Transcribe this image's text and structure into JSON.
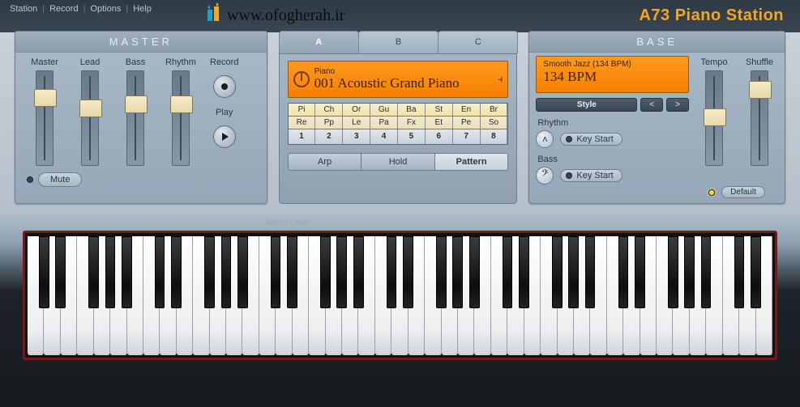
{
  "menu": {
    "items": [
      "Station",
      "Record",
      "Options",
      "Help"
    ]
  },
  "watermark": "www.ofogherah.ir",
  "app_title": "A73 Piano Station",
  "master": {
    "title": "MASTER",
    "sliders": [
      {
        "label": "Master",
        "pos": 22
      },
      {
        "label": "Lead",
        "pos": 35
      },
      {
        "label": "Bass",
        "pos": 30
      },
      {
        "label": "Rhythm",
        "pos": 30
      }
    ],
    "record": "Record",
    "play": "Play",
    "mute": "Mute"
  },
  "center": {
    "tabs": [
      "A",
      "B",
      "C"
    ],
    "active": 0,
    "lcd": {
      "category": "Piano",
      "patch": "001 Acoustic Grand Piano"
    },
    "row1": [
      "Pi",
      "Ch",
      "Or",
      "Gu",
      "Ba",
      "St",
      "En",
      "Br"
    ],
    "row2": [
      "Re",
      "Pp",
      "Le",
      "Pa",
      "Fx",
      "Et",
      "Pe",
      "So"
    ],
    "nums": [
      "1",
      "2",
      "3",
      "4",
      "5",
      "6",
      "7",
      "8"
    ],
    "seg": [
      "Arp",
      "Hold",
      "Pattern"
    ],
    "seg_active": 2
  },
  "base": {
    "title": "BASE",
    "lcd": {
      "sub": "Smooth Jazz (134 BPM)",
      "val": "134 BPM"
    },
    "style": "Style",
    "prev": "<",
    "next": ">",
    "rhythm": "Rhythm",
    "bass": "Bass",
    "keystart": "Key Start",
    "sliders": [
      {
        "label": "Tempo",
        "pos": 46
      },
      {
        "label": "Shuffle",
        "pos": 12
      }
    ],
    "default": "Default"
  },
  "split": "Bass ᵼ Lead",
  "keyboard": {
    "white_keys": 45
  }
}
